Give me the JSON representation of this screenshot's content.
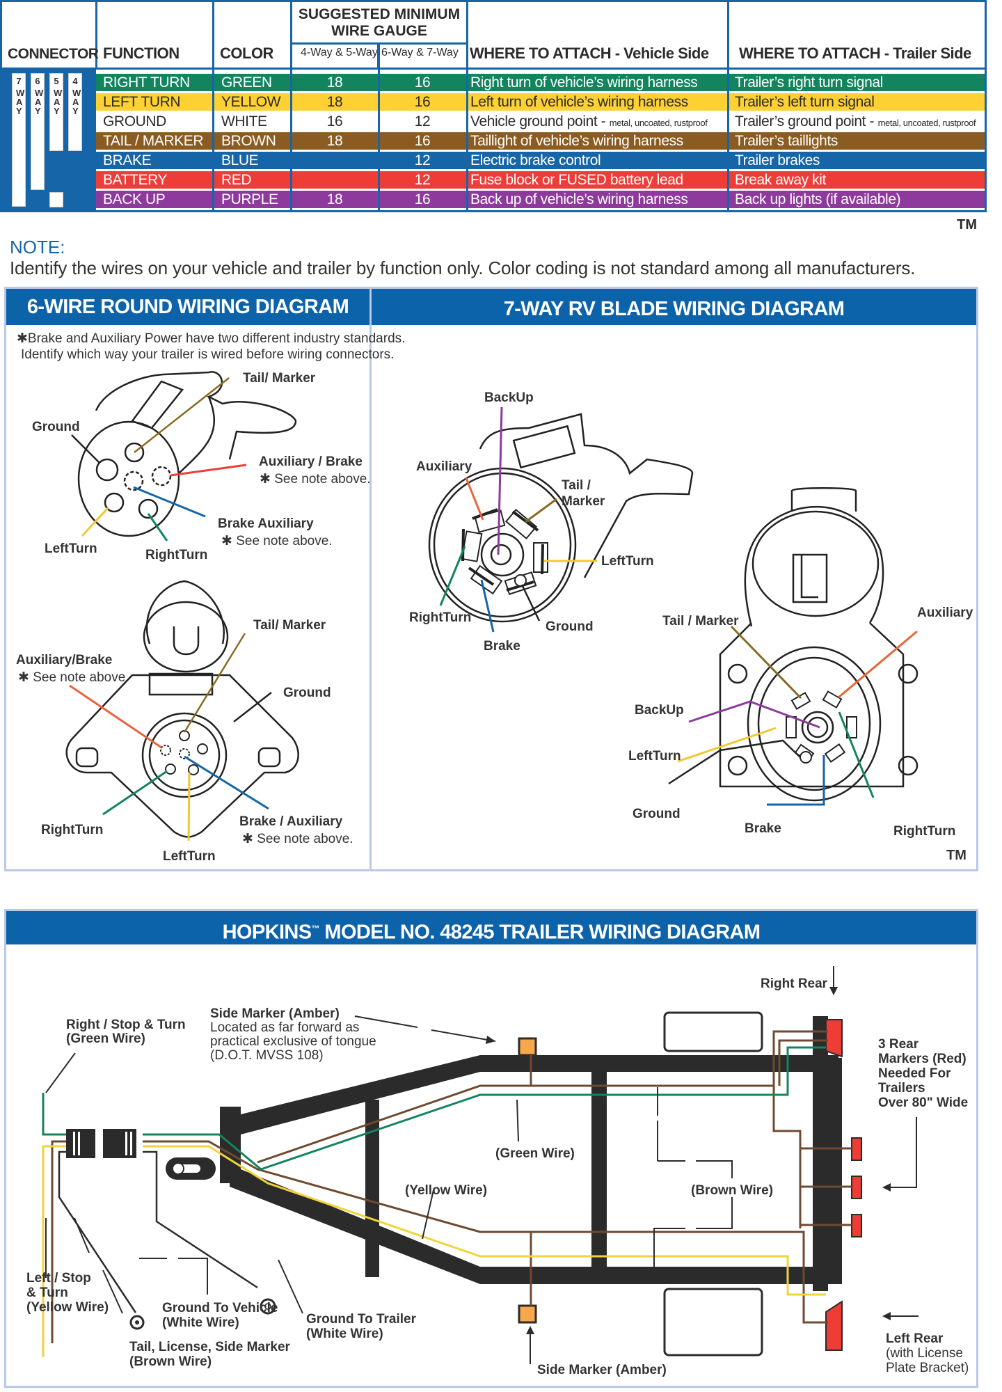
{
  "table": {
    "headers": {
      "connector": "CONNECTOR",
      "function": "FUNCTION",
      "color": "COLOR",
      "gauge_title_1": "SUGGESTED MINIMUM",
      "gauge_title_2": "WIRE GAUGE",
      "gauge_sub_1": "4-Way & 5-Way",
      "gauge_sub_2": "6-Way & 7-Way",
      "vehicle_side": "WHERE TO ATTACH - Vehicle Side",
      "trailer_side": "WHERE TO ATTACH - Trailer Side"
    },
    "connector_ways": [
      {
        "num": "7",
        "word": "WAY"
      },
      {
        "num": "6",
        "word": "WAY"
      },
      {
        "num": "5",
        "word": "WAY"
      },
      {
        "num": "4",
        "word": "WAY"
      }
    ],
    "rows": [
      {
        "function": "RIGHT TURN",
        "color": "GREEN",
        "g45": "18",
        "g67": "16",
        "vehicle": "Right turn of vehicle’s wiring harness",
        "vehicle_small": "",
        "trailer": "Trailer’s right turn signal",
        "trailer_small": "",
        "bg": "#13845e",
        "fg": "#ffffff"
      },
      {
        "function": "LEFT TURN",
        "color": "YELLOW",
        "g45": "18",
        "g67": "16",
        "vehicle": "Left turn of vehicle’s wiring harness",
        "vehicle_small": "",
        "trailer": "Trailer’s left turn signal",
        "trailer_small": "",
        "bg": "#fdd134",
        "fg": "#2b2b2b"
      },
      {
        "function": "GROUND",
        "color": "WHITE",
        "g45": "16",
        "g67": "12",
        "vehicle": "Vehicle ground point - ",
        "vehicle_small": "metal, uncoated, rustproof",
        "trailer": "Trailer’s ground point - ",
        "trailer_small": "metal, uncoated, rustproof",
        "bg": "#ffffff",
        "fg": "#2b2b2b"
      },
      {
        "function": "TAIL / MARKER",
        "color": "BROWN",
        "g45": "18",
        "g67": "16",
        "vehicle": "Taillight of vehicle’s wiring harness",
        "vehicle_small": "",
        "trailer": "Trailer’s taillights",
        "trailer_small": "",
        "bg": "#8a5c22",
        "fg": "#ffffff"
      },
      {
        "function": "BRAKE",
        "color": "BLUE",
        "g45": "",
        "g67": "12",
        "vehicle": "Electric brake control",
        "vehicle_small": "",
        "trailer": "Trailer brakes",
        "trailer_small": "",
        "bg": "#1565a8",
        "fg": "#ffffff"
      },
      {
        "function": "BATTERY",
        "color": "RED",
        "g45": "",
        "g67": "12",
        "vehicle": "Fuse block or FUSED battery lead",
        "vehicle_small": "",
        "trailer": "Break away kit",
        "trailer_small": "",
        "bg": "#ee3d36",
        "fg": "#ffffff"
      },
      {
        "function": "BACK UP",
        "color": "PURPLE",
        "g45": "18",
        "g67": "16",
        "vehicle": "Back up of vehicle’s wiring harness",
        "vehicle_small": "",
        "trailer": "Back up lights (if available)",
        "trailer_small": "",
        "bg": "#8e3a9c",
        "fg": "#ffffff"
      }
    ],
    "trademark": "TM"
  },
  "note": {
    "label": "NOTE:",
    "text": "Identify the wires on your vehicle and trailer by function only. Color coding is not standard among all manufacturers."
  },
  "six_wire": {
    "title": "6-WIRE ROUND WIRING DIAGRAM",
    "footnote_1": "✱Brake and Auxiliary Power have two different industry standards.",
    "footnote_2": "Identify which way your trailer is wired before wiring connectors.",
    "plug_labels": {
      "tail_marker": "Tail/ Marker",
      "ground": "Ground",
      "aux_brake": "Auxiliary / Brake",
      "aux_brake_note": "✱ See note above.",
      "brake_aux": "Brake Auxiliary",
      "brake_aux_note": "✱ See note above.",
      "left_turn": "LeftTurn",
      "right_turn": "RightTurn"
    },
    "socket_labels": {
      "tail_marker": "Tail/ Marker",
      "aux_brake": "Auxiliary/Brake",
      "aux_brake_note": "✱ See note above",
      "ground": "Ground",
      "right_turn": "RightTurn",
      "brake_aux": "Brake / Auxiliary",
      "brake_aux_note": "✱ See note above.",
      "left_turn": "LeftTurn"
    }
  },
  "seven_way": {
    "title": "7-WAY RV BLADE WIRING DIAGRAM",
    "plug_labels": {
      "backup": "BackUp",
      "auxiliary": "Auxiliary",
      "tail_marker_1": "Tail /",
      "tail_marker_2": "Marker",
      "left_turn": "LeftTurn",
      "right_turn": "RightTurn",
      "ground": "Ground",
      "brake": "Brake"
    },
    "socket_labels": {
      "tail_marker": "Tail / Marker",
      "auxiliary": "Auxiliary",
      "backup": "BackUp",
      "left_turn": "LeftTurn",
      "ground": "Ground",
      "brake": "Brake",
      "right_turn": "RightTurn"
    },
    "trademark": "TM"
  },
  "trailer": {
    "title": "HOPKINS",
    "title_tm": "™",
    "title_rest": " MODEL NO. 48245 TRAILER WIRING DIAGRAM",
    "labels": {
      "right_stop_1": "Right / Stop & Turn",
      "right_stop_2": "(Green Wire)",
      "side_marker_title": "Side Marker (Amber)",
      "side_marker_1": "Located as far forward as",
      "side_marker_2": "practical exclusive of tongue",
      "side_marker_3": "(D.O.T. MVSS 108)",
      "right_rear": "Right Rear",
      "rear_markers_1": "3 Rear",
      "rear_markers_2": "Markers (Red)",
      "rear_markers_3": "Needed For",
      "rear_markers_4": "Trailers",
      "rear_markers_5": "Over 80\" Wide",
      "green_wire": "(Green Wire)",
      "yellow_wire": "(Yellow Wire)",
      "brown_wire": "(Brown Wire)",
      "left_stop_1": "Left / Stop",
      "left_stop_2": "& Turn",
      "left_stop_3": "(Yellow Wire)",
      "ground_vehicle_1": "Ground To Vehicle",
      "ground_vehicle_2": "(White Wire)",
      "ground_trailer_1": "Ground To Trailer",
      "ground_trailer_2": "(White Wire)",
      "tail_license_1": "Tail, License, Side Marker",
      "tail_license_2": "(Brown Wire)",
      "side_marker_bottom": "Side Marker (Amber)",
      "left_rear_1": "Left Rear",
      "left_rear_2": "(with License",
      "left_rear_3": "Plate Bracket)"
    }
  },
  "colors": {
    "blue": "#1565a8",
    "header_blue": "#0d63aa",
    "green": "#13845e",
    "yellow": "#fdd134",
    "brown": "#8a5c22",
    "red": "#ee3d36",
    "purple": "#8e3a9c",
    "amber": "#f6a84b",
    "frame": "#2b2b2b"
  }
}
